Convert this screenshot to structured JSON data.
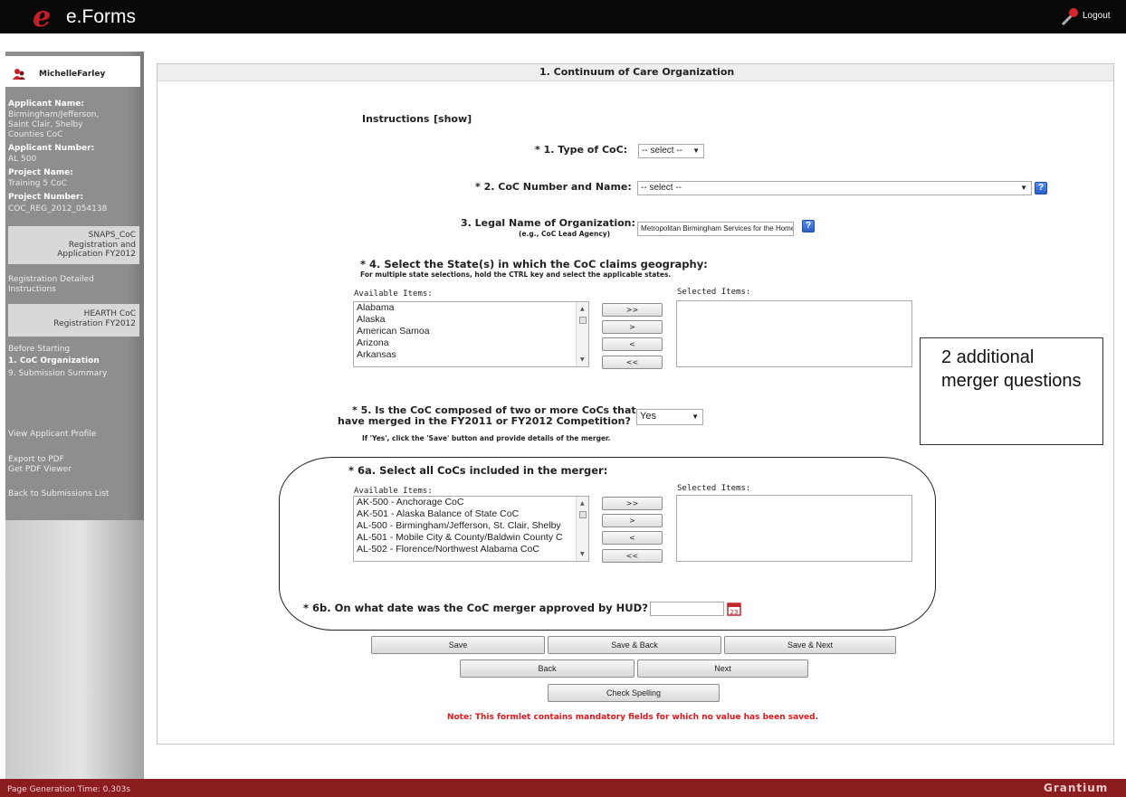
{
  "app": {
    "title": "e.Forms",
    "logo_letter": "e",
    "logout": "Logout"
  },
  "user": {
    "name": "MichelleFarley"
  },
  "applicant": {
    "name_label": "Applicant Name:",
    "name_lines": [
      "Birmingham/Jefferson,",
      "Saint Clair, Shelby",
      "Counties CoC"
    ],
    "number_label": "Applicant Number:",
    "number": "AL 500",
    "project_label": "Project Name:",
    "project": "Training 5 CoC",
    "project_number_label": "Project Number:",
    "project_number": "COC_REG_2012_054138"
  },
  "sidebar": {
    "snaps_lines": [
      "SNAPS_CoC",
      "Registration and",
      "Application FY2012"
    ],
    "reg_instructions_lines": [
      "Registration Detailed",
      "Instructions"
    ],
    "hearth_lines": [
      "HEARTH CoC",
      "Registration FY2012"
    ],
    "nav": [
      "Before Starting",
      "1. CoC Organization",
      "9. Submission Summary"
    ],
    "view_profile": "View Applicant Profile",
    "export_pdf": "Export to PDF",
    "get_viewer": "Get PDF Viewer",
    "back_list": "Back to Submissions List"
  },
  "panel": {
    "title": "1. Continuum of Care Organization"
  },
  "instructions": {
    "label": "Instructions",
    "show": "[show]"
  },
  "q1": {
    "label": "* 1. Type of CoC:",
    "value": "-- select --"
  },
  "q2": {
    "label": "* 2. CoC Number and Name:",
    "value": "-- select --"
  },
  "q3": {
    "label": "3. Legal Name of Organization:",
    "sub": "(e.g., CoC Lead Agency)",
    "value": "Metropolitan Birmingham Services for the Homeless"
  },
  "q4": {
    "label": "* 4. Select the State(s) in which the CoC claims geography:",
    "sub": "For multiple state selections, hold the CTRL key and select the applicable states.",
    "available_label": "Available Items:",
    "selected_label": "Selected Items:",
    "available": [
      "Alabama",
      "Alaska",
      "American Samoa",
      "Arizona",
      "Arkansas"
    ]
  },
  "movers": {
    "add_all": ">>",
    "add": ">",
    "remove": "<",
    "remove_all": "<<"
  },
  "q5": {
    "label_line1": "* 5. Is the CoC composed of two or more CoCs that",
    "label_line2": "have merged in the FY2011 or FY2012 Competition?",
    "sub": "If 'Yes', click the 'Save' button and provide details of the merger.",
    "value": "Yes"
  },
  "q6a": {
    "label": "* 6a. Select all CoCs included in the merger:",
    "available_label": "Available Items:",
    "selected_label": "Selected Items:",
    "available": [
      "AK-500 - Anchorage CoC",
      "AK-501 - Alaska Balance of State CoC",
      "AL-500 - Birmingham/Jefferson, St. Clair, Shelby",
      "AL-501 - Mobile City & County/Baldwin County C",
      "AL-502 - Florence/Northwest Alabama CoC"
    ]
  },
  "q6b": {
    "label": "* 6b. On what date was the CoC merger approved by HUD?",
    "value": "",
    "calendar_day": "23"
  },
  "actions": {
    "save": "Save",
    "save_back": "Save & Back",
    "save_next": "Save & Next",
    "back": "Back",
    "next": "Next",
    "spell": "Check Spelling"
  },
  "note": "Note: This formlet contains mandatory fields for which no value has been saved.",
  "callout": {
    "text": "2 additional merger questions"
  },
  "footer": {
    "gen_time": "Page Generation Time: 0.303s",
    "brand": "Grantium"
  },
  "colors": {
    "top_bar": "#080808",
    "footer": "#8b1c20",
    "logo": "#c41e2a",
    "note": "#e0171c",
    "help_icon": "#2a5fc7"
  }
}
